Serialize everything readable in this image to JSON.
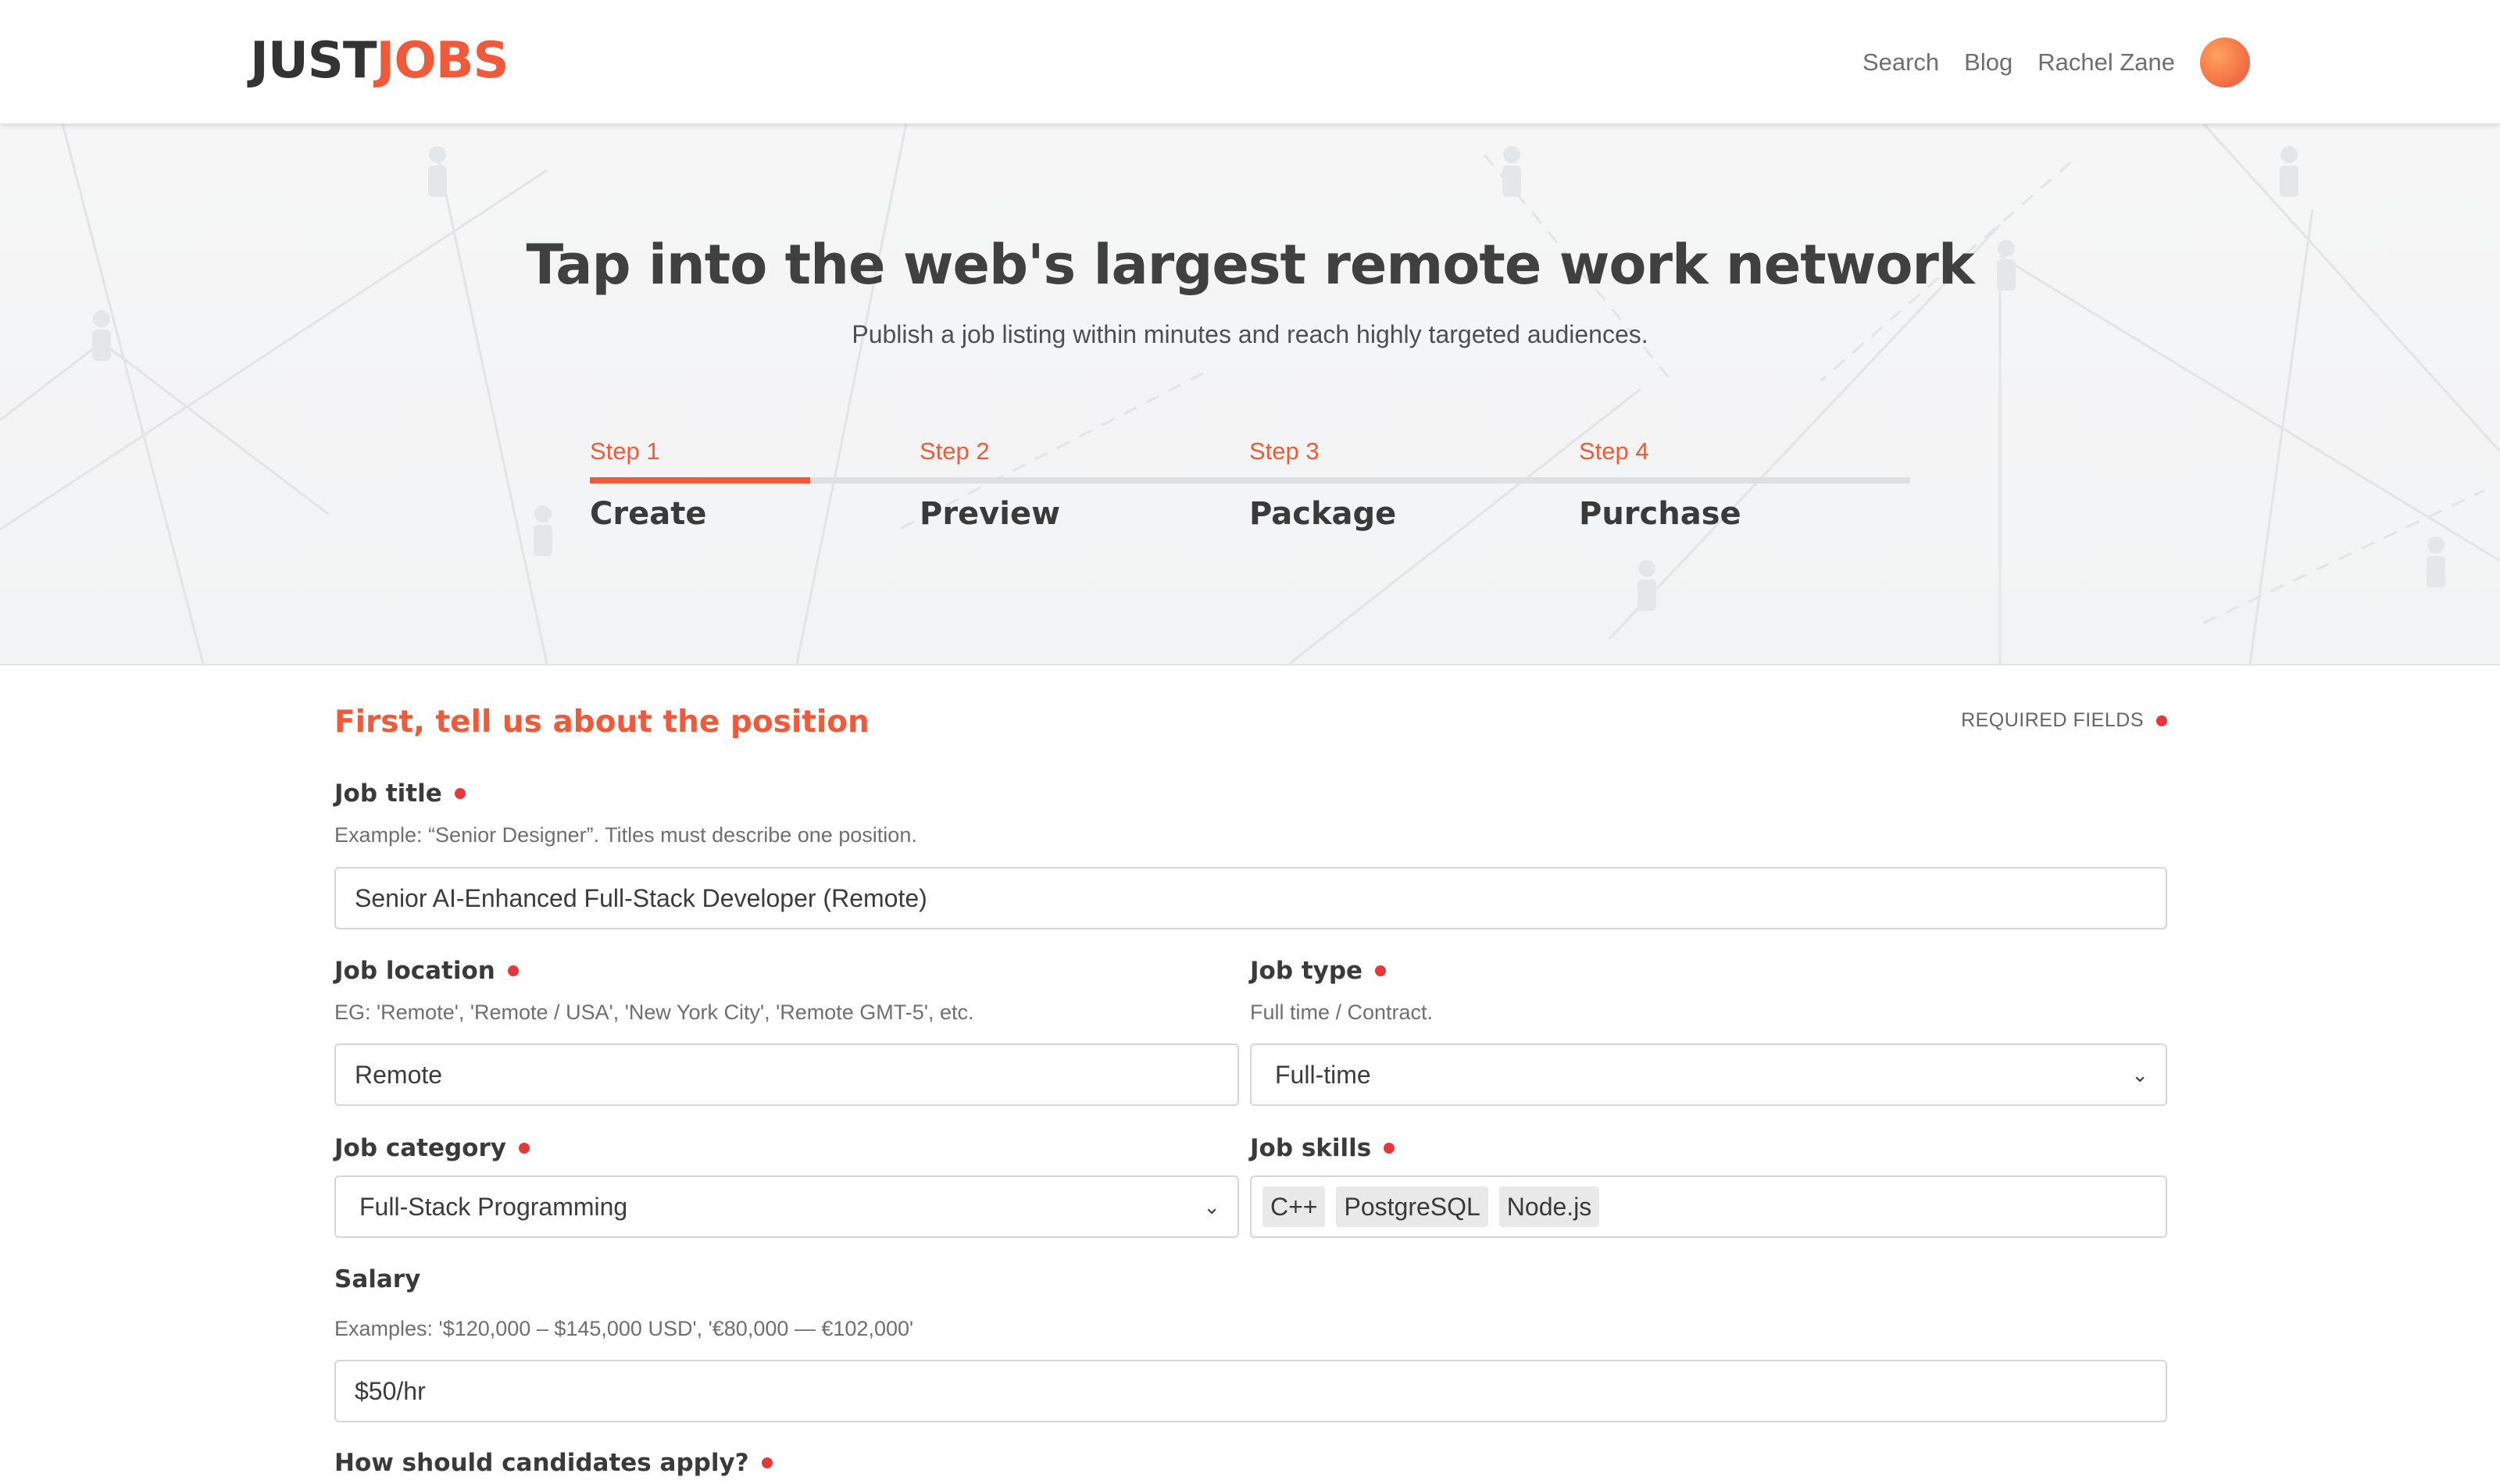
{
  "header": {
    "logo_just": "JUST",
    "logo_jobs": "JOBS",
    "nav": {
      "search": "Search",
      "blog": "Blog",
      "user": "Rachel Zane"
    }
  },
  "hero": {
    "title": "Tap into the web's largest remote work network",
    "subtitle": "Publish a job listing within minutes and reach highly targeted audiences.",
    "progress": 0.167,
    "steps": [
      {
        "num": "Step 1",
        "name": "Create"
      },
      {
        "num": "Step 2",
        "name": "Preview"
      },
      {
        "num": "Step 3",
        "name": "Package"
      },
      {
        "num": "Step 4",
        "name": "Purchase"
      }
    ]
  },
  "form": {
    "section_title": "First, tell us about the position",
    "required_note": "REQUIRED FIELDS",
    "job_title": {
      "label": "Job title",
      "hint": "Example: “Senior Designer”. Titles must describe one position.",
      "value": "Senior AI-Enhanced Full-Stack Developer (Remote)"
    },
    "job_location": {
      "label": "Job location",
      "hint": "EG: 'Remote', 'Remote / USA', 'New York City', 'Remote GMT-5', etc.",
      "value": "Remote"
    },
    "job_type": {
      "label": "Job type",
      "hint": "Full time / Contract.",
      "value": "Full-time"
    },
    "job_category": {
      "label": "Job category",
      "value": "Full-Stack Programming"
    },
    "job_skills": {
      "label": "Job skills",
      "tags": [
        "C++",
        "PostgreSQL",
        "Node.js"
      ]
    },
    "salary": {
      "label": "Salary",
      "hint": "Examples: '$120,000 – $145,000 USD', '€80,000 — €102,000'",
      "value": "$50/hr"
    },
    "apply": {
      "label": "How should candidates apply?"
    }
  },
  "icons": {
    "select_chevron": "chevron-down-icon",
    "required": "required-dot-icon"
  },
  "colors": {
    "accent": "#ef5a3a",
    "required_dot": "#e5383b"
  }
}
